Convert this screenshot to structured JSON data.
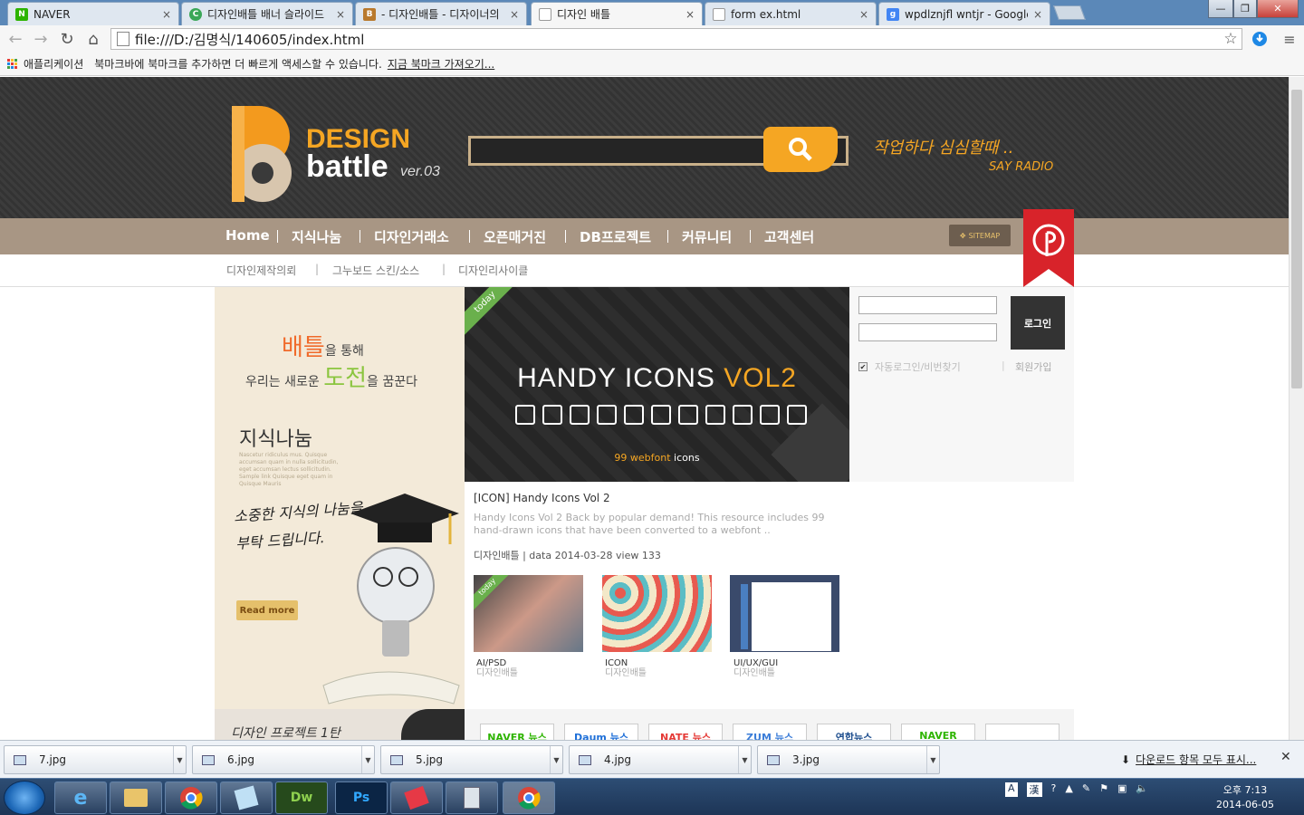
{
  "tabs": [
    {
      "title": "NAVER",
      "favicon": "naver-icon",
      "color": "#2db400",
      "letter": "N"
    },
    {
      "title": "디자인배틀 배너 슬라이드",
      "favicon": "chrome-ext-icon",
      "color": "#3aa757",
      "letter": "C"
    },
    {
      "title": "- 디자인배틀 - 디자이너의",
      "favicon": "designbattle-icon",
      "color": "#b9792c",
      "letter": "B"
    },
    {
      "title": "디자인 배틀",
      "favicon": "page-icon",
      "color": "#ffffff",
      "letter": ""
    },
    {
      "title": "form ex.html",
      "favicon": "page-icon",
      "color": "#ffffff",
      "letter": ""
    },
    {
      "title": "wpdlznjfl wntjr - Google",
      "favicon": "google-icon",
      "color": "#4285f4",
      "letter": "g"
    }
  ],
  "tab_close": "×",
  "window": {
    "min": "—",
    "max": "❐",
    "close": "✕"
  },
  "address": {
    "url": "file:///D:/김명식/140605/index.html"
  },
  "bookmarks_bar": {
    "apps": "애플리케이션",
    "message": "북마크바에 북마크를 추가하면 더 빠르게 액세스할 수 있습니다.",
    "import_link": "지금 북마크 가져오기..."
  },
  "site": {
    "logo": {
      "line1": "DESIGN",
      "line2": "battle",
      "version": "ver.03"
    },
    "radio": {
      "line1": "작업하다 심심할때 ..",
      "line2": "SAY RADIO"
    },
    "nav": [
      "Home",
      "지식나눔",
      "디자인거래소",
      "오픈매거진",
      "DB프로젝트",
      "커뮤니티",
      "고객센터"
    ],
    "sitemap": "SITEMAP",
    "subnav": [
      "디자인제작의뢰",
      "그누보드 스킨/소스",
      "디자인리사이클"
    ],
    "banner": {
      "battle_word": "배틀",
      "line1_rest": "을 통해",
      "line2_pre": "우리는 새로운 ",
      "challenge_word": "도전",
      "line2_rest": "을 꿈꾼다",
      "title": "지식나눔",
      "lorem": "Nascetur ridiculus mus. Quisque accumsan quam in nulla sollicitudin, eget accumsan lectus sollicitudin. Sample link Quisque eget quam in Quisque Mauris",
      "handwriting1": "소중한 지식의 나눔을",
      "handwriting2": "부탁 드립니다.",
      "readmore": "Read more",
      "project": "디자인 프로젝트 1탄"
    },
    "feature": {
      "ribbon": "today",
      "title_main": "HANDY ICONS ",
      "title_accent": "VOL2",
      "count": "99 webfont",
      "count_rest": " icons"
    },
    "post": {
      "title": "[ICON]  Handy Icons Vol 2",
      "desc": "Handy Icons Vol 2 Back by popular demand! This resource includes 99 hand-drawn icons that have been converted to a webfont ..",
      "author": "디자인배틀",
      "meta": " | data 2014-03-28  view 133"
    },
    "thumbs": [
      {
        "category": "AI/PSD",
        "author": "디자인배틀"
      },
      {
        "category": "ICON",
        "author": "디자인배틀"
      },
      {
        "category": "UI/UX/GUI",
        "author": "디자인배틀"
      }
    ],
    "login": {
      "button": "로그인",
      "auto": "자동로그인/비번찾기",
      "sep": "|",
      "join": "회원가입"
    },
    "news": [
      "NAVER 뉴스",
      "Daum 뉴스",
      "NATE 뉴스",
      "ZUM 뉴스",
      "연합뉴스",
      "NAVER",
      ""
    ]
  },
  "downloads": {
    "items": [
      "7.jpg",
      "6.jpg",
      "5.jpg",
      "4.jpg",
      "3.jpg"
    ],
    "show_all": "다운로드 항목 모두 표시...",
    "close": "✕"
  },
  "taskbar": {
    "apps": [
      "ie-icon",
      "explorer-icon",
      "chrome-icon",
      "notepad-icon",
      "dreamweaver-icon",
      "photoshop-icon",
      "paint-icon",
      "calculator-icon",
      "chrome-icon"
    ],
    "dw": "Dw",
    "ps": "Ps",
    "clock_time": "오후 7:13",
    "clock_date": "2014-06-05",
    "ime": "A",
    "ime2": "漢"
  },
  "colors": {
    "accent": "#f5a623",
    "nav": "#a89684",
    "header": "#3a3a3a"
  }
}
